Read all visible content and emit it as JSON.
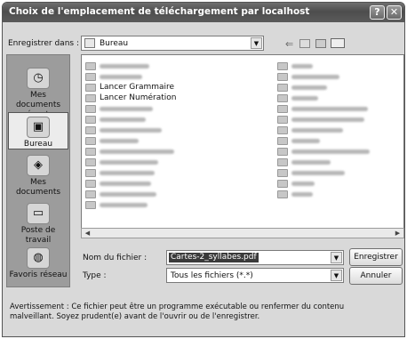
{
  "window": {
    "title": "Choix de l'emplacement de téléchargement par localhost"
  },
  "titlebar": {
    "help_label": "?",
    "close_label": "✕"
  },
  "lookin": {
    "label": "Enregistrer dans :",
    "value": "Bureau",
    "arrow": "▼"
  },
  "toolbar": [
    "back-icon",
    "up-folder-icon",
    "new-folder-icon",
    "views-menu-icon"
  ],
  "places": [
    {
      "label": "Mes documents récents",
      "icon": "recent-documents-icon"
    },
    {
      "label": "Bureau",
      "icon": "desktop-icon"
    },
    {
      "label": "Mes documents",
      "icon": "my-documents-icon"
    },
    {
      "label": "Poste de travail",
      "icon": "my-computer-icon"
    },
    {
      "label": "Favoris réseau",
      "icon": "network-places-icon"
    }
  ],
  "files": {
    "visible": [
      {
        "label": "Lancer Grammaire",
        "icon": "shortcut-icon"
      },
      {
        "label": "Lancer Numération",
        "icon": "shortcut-icon"
      }
    ]
  },
  "filename": {
    "label": "Nom du fichier :",
    "value": "Cartes-2_syllabes.pdf",
    "arrow": "▼"
  },
  "filetype": {
    "label": "Type :",
    "value": "Tous les fichiers (*.*)",
    "arrow": "▼"
  },
  "buttons": {
    "save": "Enregistrer",
    "cancel": "Annuler"
  },
  "warning": {
    "line1": "Avertissement : Ce fichier peut être un programme exécutable ou renfermer du contenu",
    "line2": "malveillant. Soyez prudent(e) avant de l'ouvrir ou de l'enregistrer."
  }
}
